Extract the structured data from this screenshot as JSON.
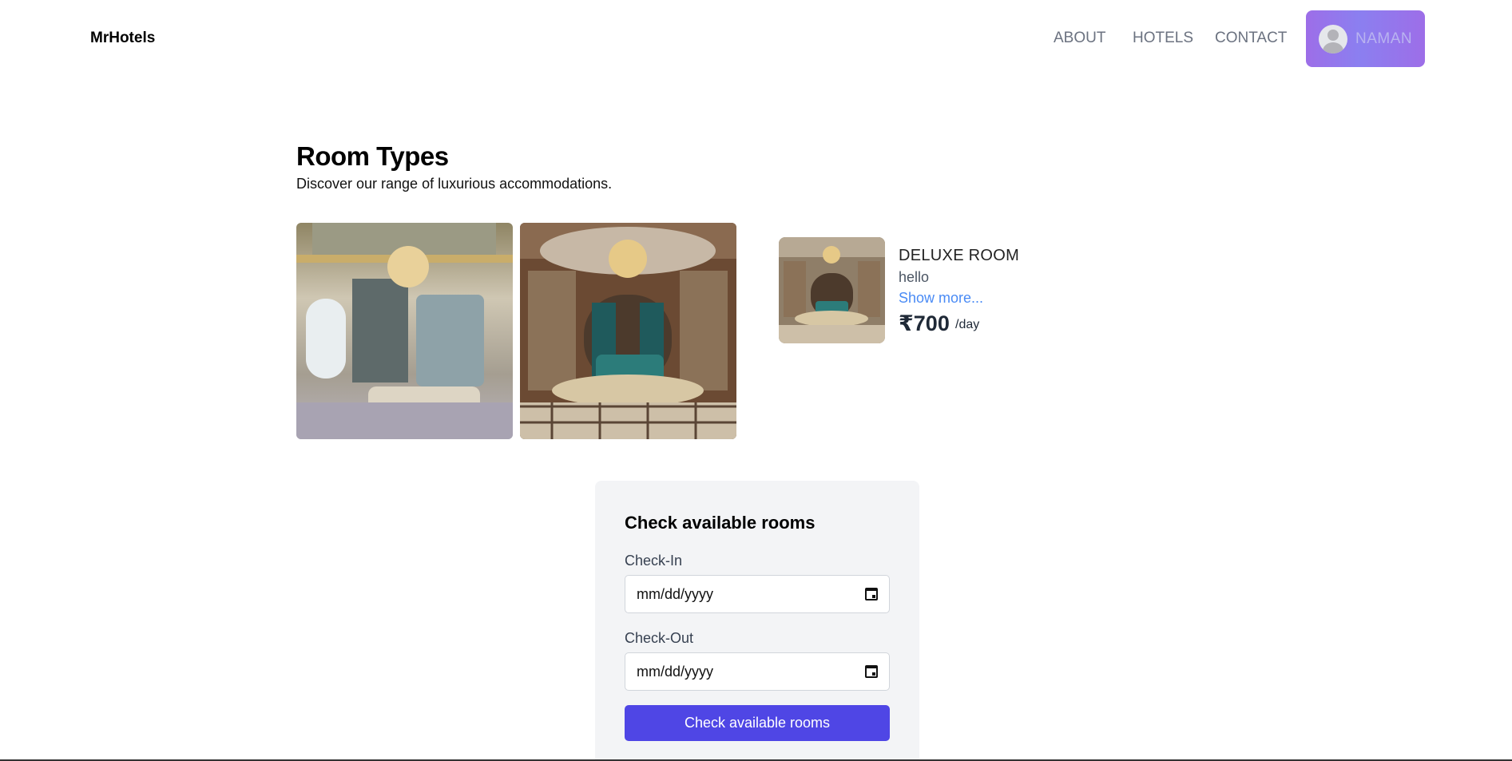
{
  "header": {
    "brand": "MrHotels",
    "nav": [
      "ABOUT",
      "HOTELS",
      "CONTACT"
    ],
    "user_name": "NAMAN"
  },
  "room_types": {
    "title": "Room Types",
    "subtitle": "Discover our range of luxurious accommodations."
  },
  "room": {
    "name": "DELUXE ROOM",
    "description": "hello",
    "show_more": "Show more...",
    "price": "₹700",
    "unit": "/day"
  },
  "form": {
    "title": "Check available rooms",
    "checkin_label": "Check-In",
    "checkin_value": "mm/dd/yyyy",
    "checkout_label": "Check-Out",
    "checkout_value": "mm/dd/yyyy",
    "submit_label": "Check available rooms"
  },
  "colors": {
    "accent": "#4f46e5",
    "link": "#4a8bf5",
    "user_button": "#9d6ee8"
  },
  "icons": {
    "avatar": "user-avatar-icon",
    "date": "calendar-icon"
  }
}
